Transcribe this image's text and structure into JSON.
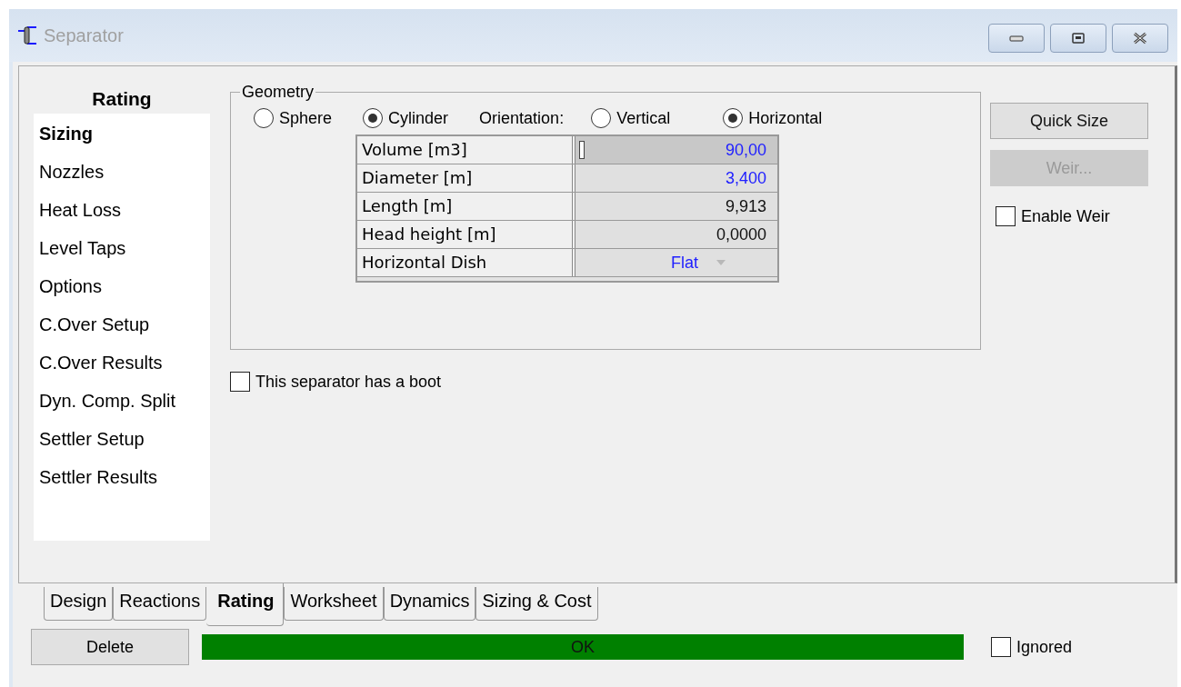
{
  "window": {
    "title": "Separator"
  },
  "sidebar": {
    "heading": "Rating",
    "items": [
      {
        "label": "Sizing",
        "selected": true
      },
      {
        "label": "Nozzles",
        "selected": false
      },
      {
        "label": "Heat Loss",
        "selected": false
      },
      {
        "label": "Level Taps",
        "selected": false
      },
      {
        "label": "Options",
        "selected": false
      },
      {
        "label": "C.Over Setup",
        "selected": false
      },
      {
        "label": "C.Over Results",
        "selected": false
      },
      {
        "label": "Dyn. Comp. Split",
        "selected": false
      },
      {
        "label": "Settler Setup",
        "selected": false
      },
      {
        "label": "Settler Results",
        "selected": false
      }
    ]
  },
  "geometry": {
    "title": "Geometry",
    "shapes": [
      {
        "label": "Sphere",
        "selected": false
      },
      {
        "label": "Cylinder",
        "selected": true
      }
    ],
    "orientation_label": "Orientation:",
    "orientations": [
      {
        "label": "Vertical",
        "selected": false
      },
      {
        "label": "Horizontal",
        "selected": true
      }
    ],
    "table": [
      {
        "label": "Volume [m3]",
        "value": "90,00",
        "kind": "input"
      },
      {
        "label": "Diameter [m]",
        "value": "3,400",
        "kind": "input"
      },
      {
        "label": "Length [m]",
        "value": "9,913",
        "kind": "calculated"
      },
      {
        "label": "Head height [m]",
        "value": "0,0000",
        "kind": "calculated"
      },
      {
        "label": "Horizontal Dish",
        "value": "Flat",
        "kind": "dropdown"
      }
    ]
  },
  "boot": {
    "label": "This separator has a boot",
    "checked": false
  },
  "buttons": [
    {
      "label": "Quick Size",
      "disabled": false
    },
    {
      "label": "Weir...",
      "disabled": true
    }
  ],
  "enable_weir": {
    "label": "Enable Weir",
    "checked": false
  },
  "tabs": [
    {
      "label": "Design",
      "selected": false
    },
    {
      "label": "Reactions",
      "selected": false
    },
    {
      "label": "Rating",
      "selected": true
    },
    {
      "label": "Worksheet",
      "selected": false
    },
    {
      "label": "Dynamics",
      "selected": false
    },
    {
      "label": "Sizing & Cost",
      "selected": false
    }
  ],
  "footer": {
    "delete": "Delete",
    "status": "OK",
    "ignored": {
      "label": "Ignored",
      "checked": false
    }
  }
}
